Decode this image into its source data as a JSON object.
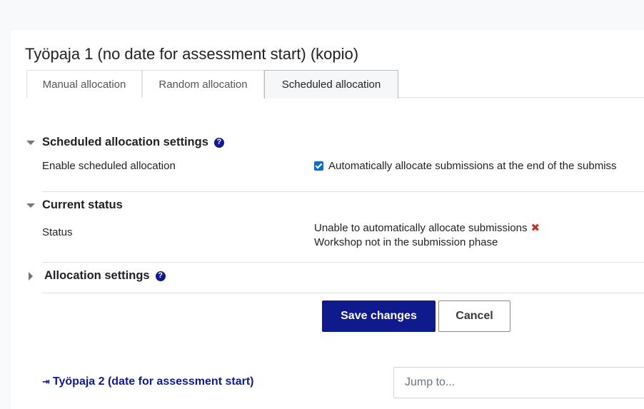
{
  "page": {
    "title": "Työpaja 1 (no date for assessment start) (kopio)"
  },
  "tabs": [
    {
      "label": "Manual allocation"
    },
    {
      "label": "Random allocation"
    },
    {
      "label": "Scheduled allocation",
      "active": true
    }
  ],
  "sections": {
    "scheduled": {
      "title": "Scheduled allocation settings",
      "field_label": "Enable scheduled allocation",
      "checkbox_label": "Automatically allocate submissions at the end of the submiss",
      "checked": true
    },
    "status": {
      "title": "Current status",
      "field_label": "Status",
      "line1": "Unable to automatically allocate submissions",
      "line2": "Workshop not in the submission phase"
    },
    "allocation": {
      "title": "Allocation settings"
    }
  },
  "icons": {
    "help": "?",
    "error": "✖",
    "prev_arrow": "⇥"
  },
  "buttons": {
    "save": "Save changes",
    "cancel": "Cancel"
  },
  "nav": {
    "prev_link": "Työpaja 2 (date for assessment start)",
    "jump_placeholder": "Jump to..."
  },
  "colors": {
    "primary": "#0f1b8c",
    "error": "#ca3120",
    "checkbox": "#0f6cbf"
  }
}
